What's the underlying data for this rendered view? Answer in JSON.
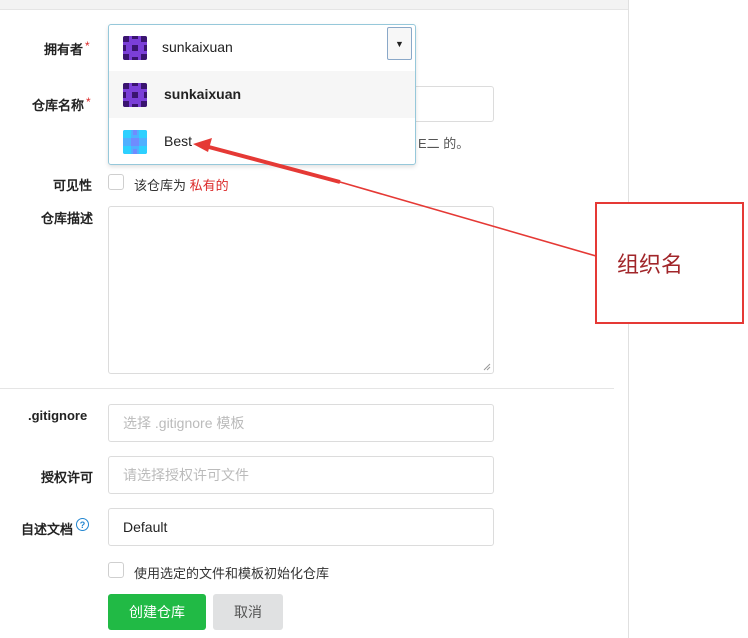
{
  "form": {
    "owner_label": "拥有者",
    "required_mark": "*",
    "repo_name_label": "仓库名称",
    "repo_name_hint_tail": "E二 的。",
    "visibility_label": "可见性",
    "visibility_text_prefix": "该仓库为",
    "visibility_text_private": "私有的",
    "description_label": "仓库描述",
    "gitignore_label": ".gitignore",
    "gitignore_placeholder": "选择 .gitignore 模板",
    "license_label": "授权许可",
    "license_placeholder": "请选择授权许可文件",
    "readme_label": "自述文档",
    "readme_value": "Default",
    "init_checkbox_text": "使用选定的文件和模板初始化仓库",
    "create_button": "创建仓库",
    "cancel_button": "取消"
  },
  "owner_dropdown": {
    "selected": "sunkaixuan",
    "options": [
      {
        "label": "sunkaixuan"
      },
      {
        "label": "Best"
      }
    ]
  },
  "annotation": {
    "text": "组织名",
    "color": "#e53935"
  },
  "colors": {
    "primary_button": "#21ba45",
    "required": "#db2828",
    "dropdown_border": "#96c8da"
  }
}
